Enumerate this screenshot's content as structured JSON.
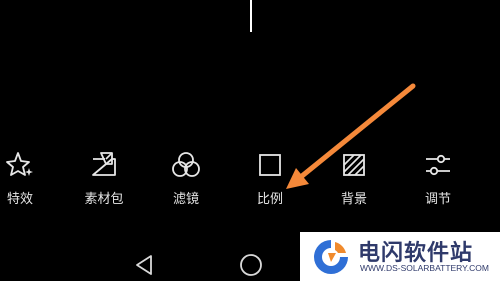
{
  "toolbar": {
    "items": [
      {
        "label": "特效",
        "icon": "sparkle-icon"
      },
      {
        "label": "素材包",
        "icon": "sticker-icon"
      },
      {
        "label": "滤镜",
        "icon": "filter-icon"
      },
      {
        "label": "比例",
        "icon": "aspect-ratio-icon"
      },
      {
        "label": "背景",
        "icon": "background-icon"
      },
      {
        "label": "调节",
        "icon": "adjust-sliders-icon"
      }
    ]
  },
  "annotation": {
    "color": "#f5893a",
    "target": "比例"
  },
  "navbar": {
    "icons": [
      "back-icon",
      "home-icon"
    ]
  },
  "watermark": {
    "title": "电闪软件站",
    "url": "WWW.DS-SOLARBATTERY.COM",
    "colors": {
      "blue": "#2f6fd6",
      "orange": "#f08a2c",
      "text": "#2f3a6b"
    }
  }
}
